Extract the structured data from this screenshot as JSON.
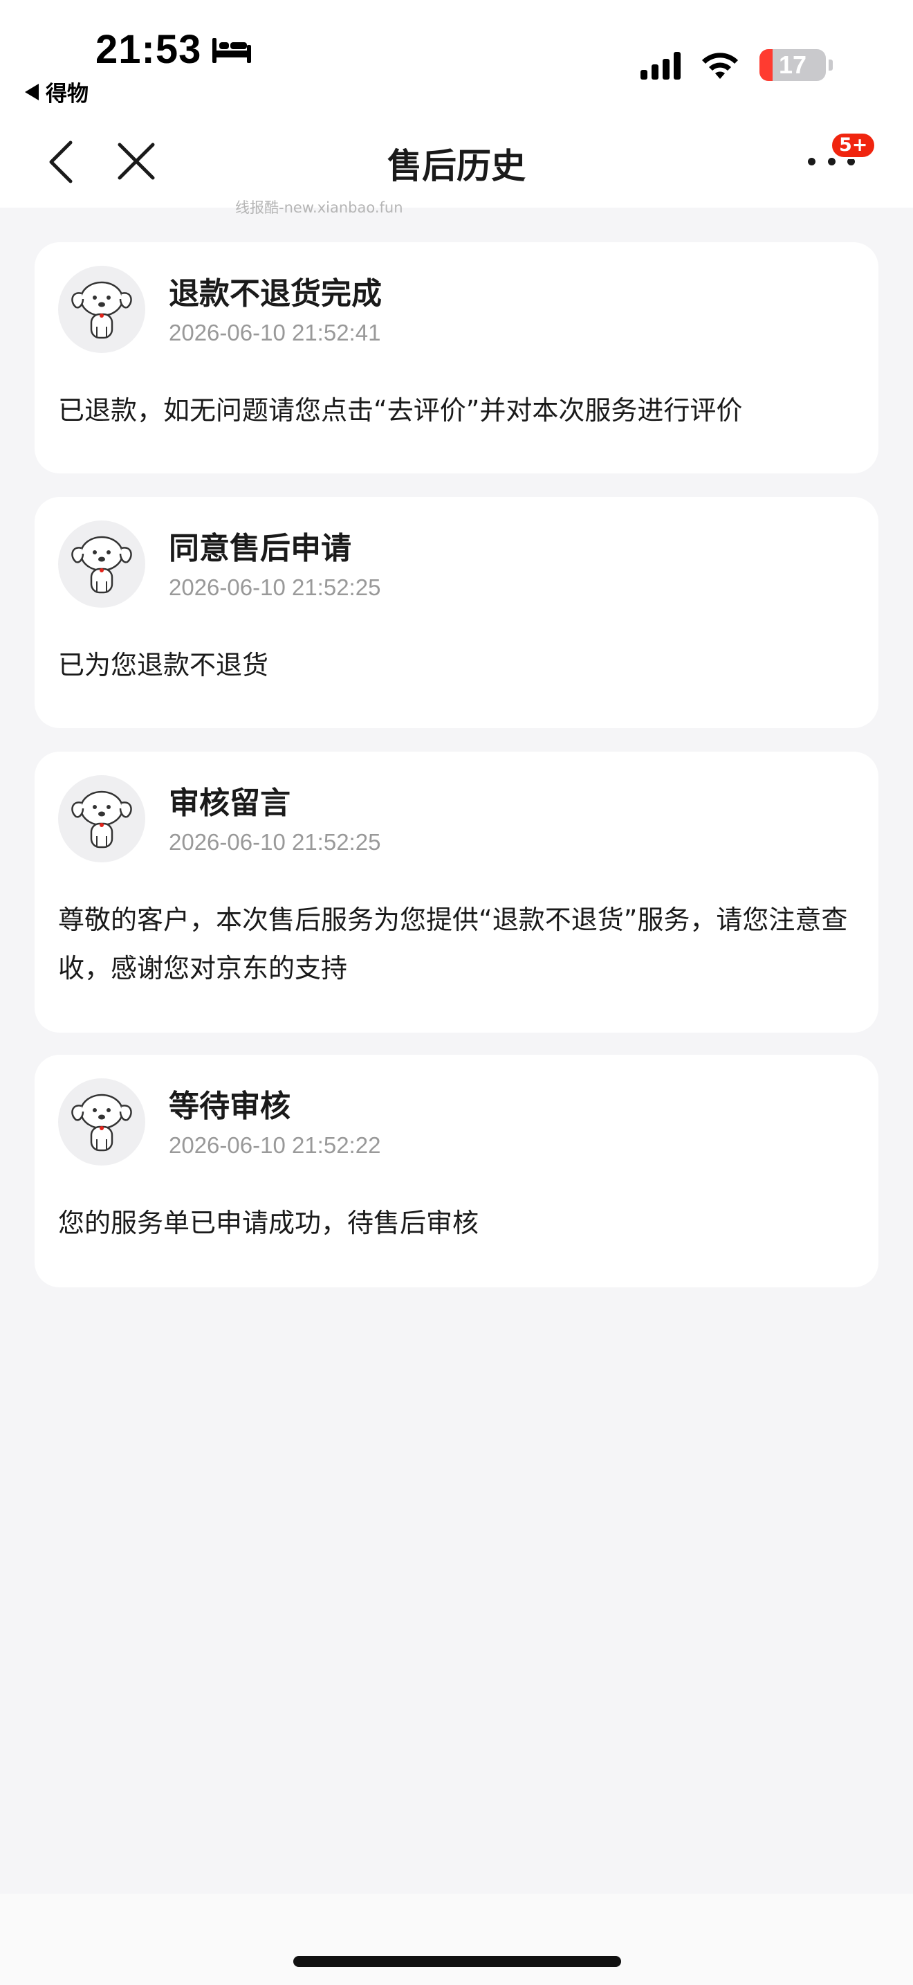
{
  "status_bar": {
    "time": "21:53",
    "back_app": "得物",
    "battery": "17",
    "icons": [
      "bed-icon",
      "signal-icon",
      "wifi-icon",
      "battery-icon"
    ]
  },
  "nav": {
    "title": "售后历史",
    "badge": "5+",
    "icons": [
      "back-chevron-icon",
      "close-icon",
      "more-icon"
    ]
  },
  "watermark": "线报酷-new.xianbao.fun",
  "colors": {
    "background": "#f5f5f7",
    "card": "#ffffff",
    "badge": "#f0250f",
    "battery_low": "#ff3b30",
    "muted_text": "#999999"
  },
  "history": [
    {
      "title": "退款不退货完成",
      "time": "2026-06-10 21:52:41",
      "message": "已退款，如无问题请您点击“去评价”并对本次服务进行评价"
    },
    {
      "title": "同意售后申请",
      "time": "2026-06-10 21:52:25",
      "message": "已为您退款不退货"
    },
    {
      "title": "审核留言",
      "time": "2026-06-10 21:52:25",
      "message": "尊敬的客户，本次售后服务为您提供“退款不退货”服务，请您注意查收，感谢您对京东的支持"
    },
    {
      "title": "等待审核",
      "time": "2026-06-10 21:52:22",
      "message": "您的服务单已申请成功，待售后审核"
    }
  ]
}
